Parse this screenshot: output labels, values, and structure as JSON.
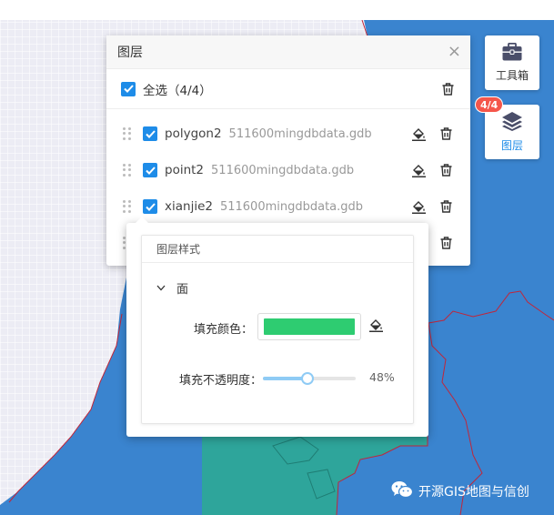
{
  "tools": {
    "toolbox_label": "工具箱",
    "layers_label": "图层",
    "layers_badge": "4/4"
  },
  "layer_panel": {
    "title": "图层",
    "select_all_label": "全选（4/4）",
    "layers": [
      {
        "name": "polygon2",
        "source": "511600mingdbdata.gdb"
      },
      {
        "name": "point2",
        "source": "511600mingdbdata.gdb"
      },
      {
        "name": "xianjie2",
        "source": "511600mingdbdata.gdb"
      }
    ]
  },
  "style_popup": {
    "title": "图层样式",
    "section_label": "面",
    "fill_color_label": "填充颜色：",
    "fill_color": "#2ecc71",
    "opacity_label": "填充不透明度：",
    "opacity_value": "48%",
    "opacity_fraction": 0.48
  },
  "colors": {
    "accent": "#1e8ce8",
    "map_water": "#3a84cf",
    "map_polygon": "#2ea59b",
    "badge": "#f5564b"
  },
  "watermark": "开源GIS地图与信创"
}
